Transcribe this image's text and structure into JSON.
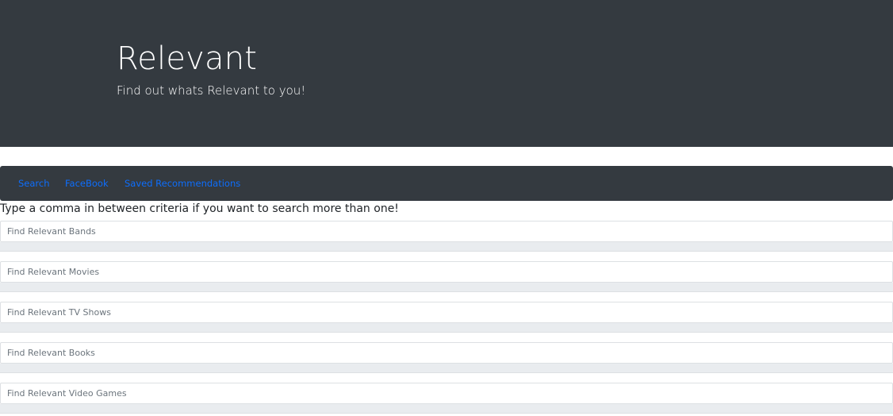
{
  "hero": {
    "title": "Relevant",
    "subtitle": "Find out whats Relevant to you!"
  },
  "nav": {
    "items": [
      {
        "label": "Search"
      },
      {
        "label": "FaceBook"
      },
      {
        "label": "Saved Recommendations"
      }
    ]
  },
  "main": {
    "hint": "Type a comma in between criteria if you want to search more than one!",
    "searches": [
      {
        "placeholder": "Find Relevant Bands"
      },
      {
        "placeholder": "Find Relevant Movies"
      },
      {
        "placeholder": "Find Relevant TV Shows"
      },
      {
        "placeholder": "Find Relevant Books"
      },
      {
        "placeholder": "Find Relevant Video Games"
      }
    ]
  },
  "colors": {
    "dark_bg": "#343a40",
    "link": "#0d6efd",
    "results_bg": "#e9ecef"
  }
}
